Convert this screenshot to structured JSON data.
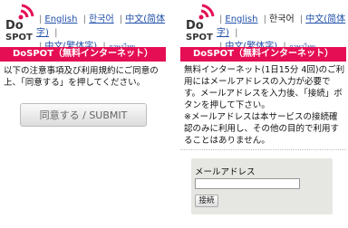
{
  "logo": {
    "text_top": "Do",
    "text_bottom": "SPOT"
  },
  "languages": [
    {
      "label": "English"
    },
    {
      "label": "한국어"
    },
    {
      "label": "中文(简体字)"
    },
    {
      "label": "中文(繁体字)"
    },
    {
      "label": "ภาษาไทย"
    }
  ],
  "left": {
    "title": "DoSPOT（無料インターネット）",
    "instructions": "以下の注意事項及び利用規約にご同意の上、「同意する」を押してください。",
    "submit_label": "同意する / SUBMIT"
  },
  "right": {
    "title": "DoSPOT（無料インターネット）",
    "instructions_line1": "無料インターネット(1日15分 4回)のご利用にはメールアドレスの入力が必要です。メールアドレスを入力後、「接続」ボタンを押して下さい。",
    "instructions_line2": "※メールアドレスは本サービスの接続確認のみに利用し、その他の目的で利用することはありません。",
    "email_label": "メールアドレス",
    "email_value": "",
    "connect_label": "接続"
  },
  "colors": {
    "accent": "#e50e54",
    "link": "#1f4fa8"
  }
}
